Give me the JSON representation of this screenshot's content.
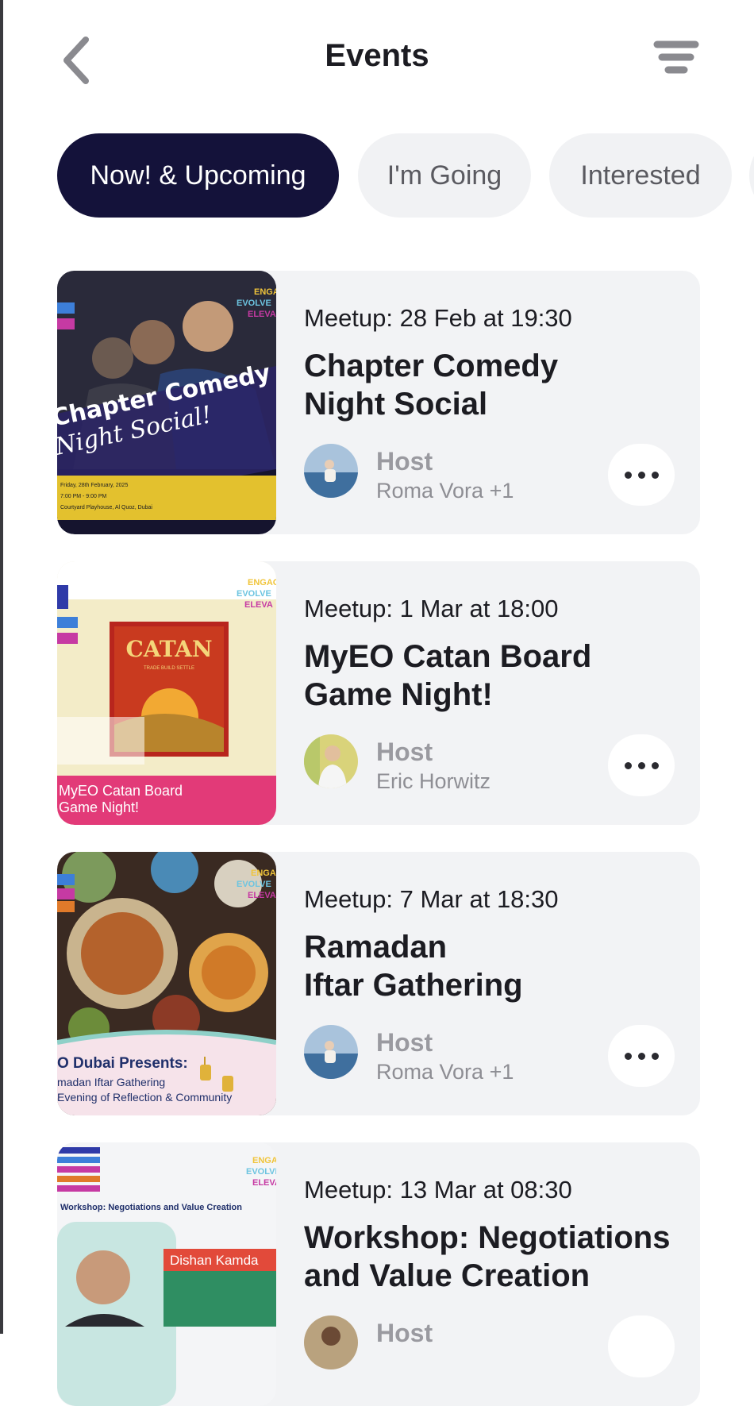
{
  "header": {
    "title": "Events",
    "back_icon": "chevron-left-icon",
    "filter_icon": "filter-lines-icon"
  },
  "tabs": [
    {
      "label": "Now! & Upcoming",
      "active": true
    },
    {
      "label": "I'm Going",
      "active": false
    },
    {
      "label": "Interested",
      "active": false
    }
  ],
  "colors": {
    "active_tab": "#14123a",
    "card_bg": "#f2f3f5",
    "tab_bg": "#f1f2f4"
  },
  "events": [
    {
      "meta": "Meetup: 28 Feb at 19:30",
      "title_line1": "Chapter Comedy",
      "title_line2": "Night Social",
      "host_label": "Host",
      "host_name": "Roma Vora +1",
      "poster_text_1": "Chapter Comedy",
      "poster_text_2": "Night Social!",
      "poster_details_1": "Friday, 28th February, 2025",
      "poster_details_2": "7:00 PM - 9:00 PM",
      "poster_details_3": "Courtyard Playhouse, Al Quoz, Dubai"
    },
    {
      "meta": "Meetup: 1 Mar at 18:00",
      "title_line1": "MyEO Catan Board",
      "title_line2": "Game Night!",
      "host_label": "Host",
      "host_name": "Eric Horwitz",
      "poster_box_title": "CATAN",
      "poster_box_sub": "TRADE BUILD SETTLE",
      "poster_footer_1": "MyEO Catan Board",
      "poster_footer_2": "Game Night!"
    },
    {
      "meta": "Meetup: 7 Mar at 18:30",
      "title_line1": "Ramadan",
      "title_line2": "Iftar Gathering",
      "host_label": "Host",
      "host_name": "Roma Vora +1",
      "poster_footer_1": "O Dubai Presents:",
      "poster_footer_2": "madan Iftar Gathering",
      "poster_footer_3": "Evening of Reflection & Community"
    },
    {
      "meta": "Meetup: 13 Mar at 08:30",
      "title_line1": "Workshop: Negotiations",
      "title_line2": "and Value Creation",
      "host_label": "Host",
      "host_name": "",
      "poster_heading": "Workshop: Negotiations and Value Creation",
      "poster_speaker": "Dishan Kamda"
    }
  ]
}
